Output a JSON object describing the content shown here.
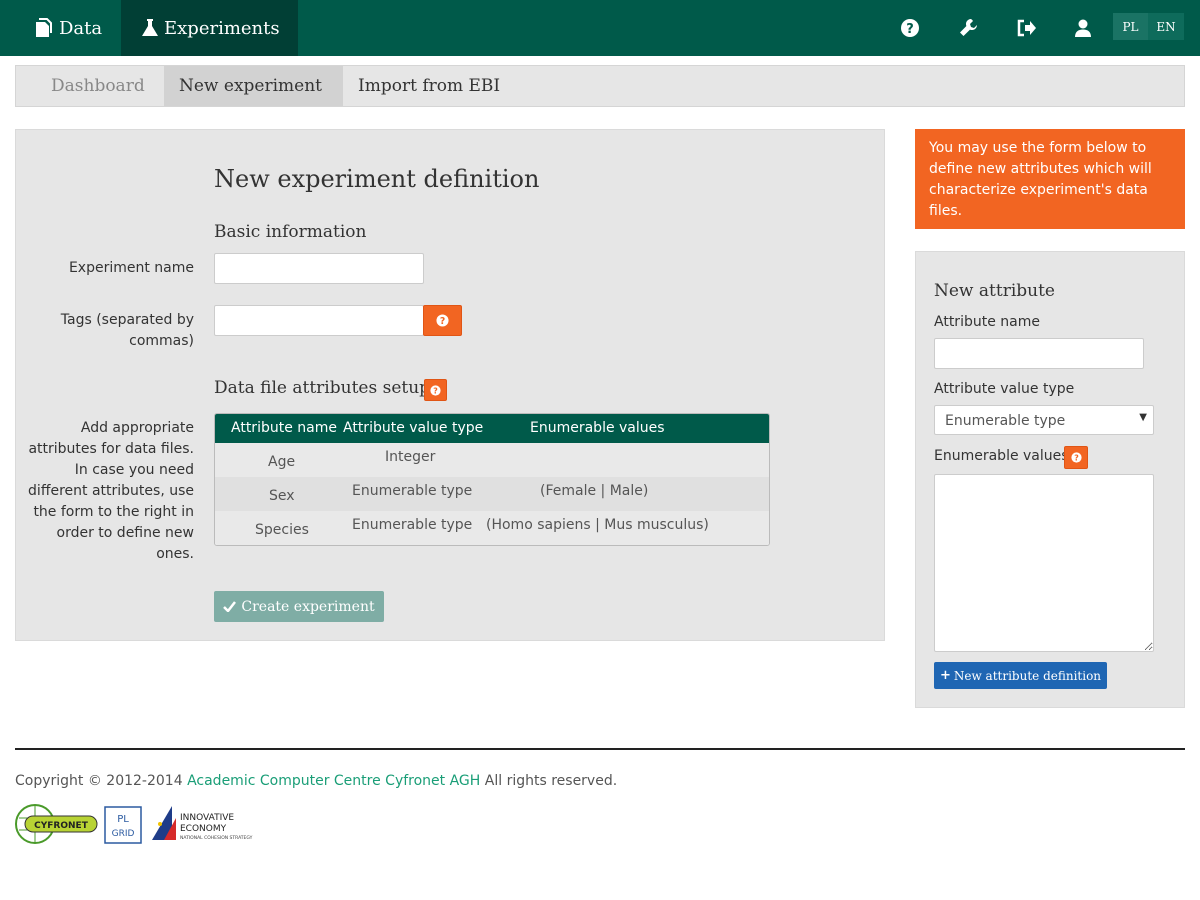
{
  "nav": {
    "data_label": "Data",
    "experiments_label": "Experiments",
    "lang_pl": "PL",
    "lang_en": "EN",
    "brand_color": "#005a4a"
  },
  "tabs": [
    {
      "label": "Dashboard",
      "active": false
    },
    {
      "label": "New experiment",
      "active": true
    },
    {
      "label": "Import from EBI",
      "active": false
    }
  ],
  "form": {
    "title": "New experiment definition",
    "basic_heading": "Basic information",
    "experiment_name_label": "Experiment name",
    "experiment_name_value": "",
    "tags_label_1": "Tags (separated by",
    "tags_label_2": "commas)",
    "tags_value": "",
    "attributes_heading": "Data file attributes setup",
    "attributes_hint": [
      "Add appropriate",
      "attributes for data files.",
      "In case you need",
      "different attributes, use",
      "the form to the right in",
      "order to define new",
      "ones."
    ],
    "create_button": "Create experiment"
  },
  "attr_table": {
    "headers": [
      "Attribute name",
      "Attribute value type",
      "Enumerable values"
    ],
    "rows": [
      {
        "name": "Age",
        "type": "Integer",
        "values": ""
      },
      {
        "name": "Sex",
        "type": "Enumerable type",
        "values": "(Female | Male)"
      },
      {
        "name": "Species",
        "type": "Enumerable type",
        "values": "(Homo sapiens | Mus musculus)"
      }
    ]
  },
  "sidebar": {
    "info": [
      "You may use the form below to",
      "define new attributes which will",
      "characterize experiment's data",
      "files."
    ],
    "title": "New attribute",
    "attr_name_label": "Attribute name",
    "attr_name_value": "",
    "value_type_label": "Attribute value type",
    "value_type_selected": "Enumerable type",
    "enum_values_label": "Enumerable values",
    "enum_values_value": "",
    "new_attr_button": "New attribute definition",
    "accent_color": "#f26522"
  },
  "footer": {
    "copyright_prefix": "Copyright © 2012-2014",
    "org_link": "Academic Computer Centre Cyfronet AGH",
    "copyright_suffix": "All rights reserved.",
    "logo_cyfronet": "CYFRONET",
    "logo_plgrid": "PL GRID",
    "logo_ie_1": "INNOVATIVE",
    "logo_ie_2": "ECONOMY",
    "logo_ie_3": "NATIONAL COHESION STRATEGY"
  }
}
